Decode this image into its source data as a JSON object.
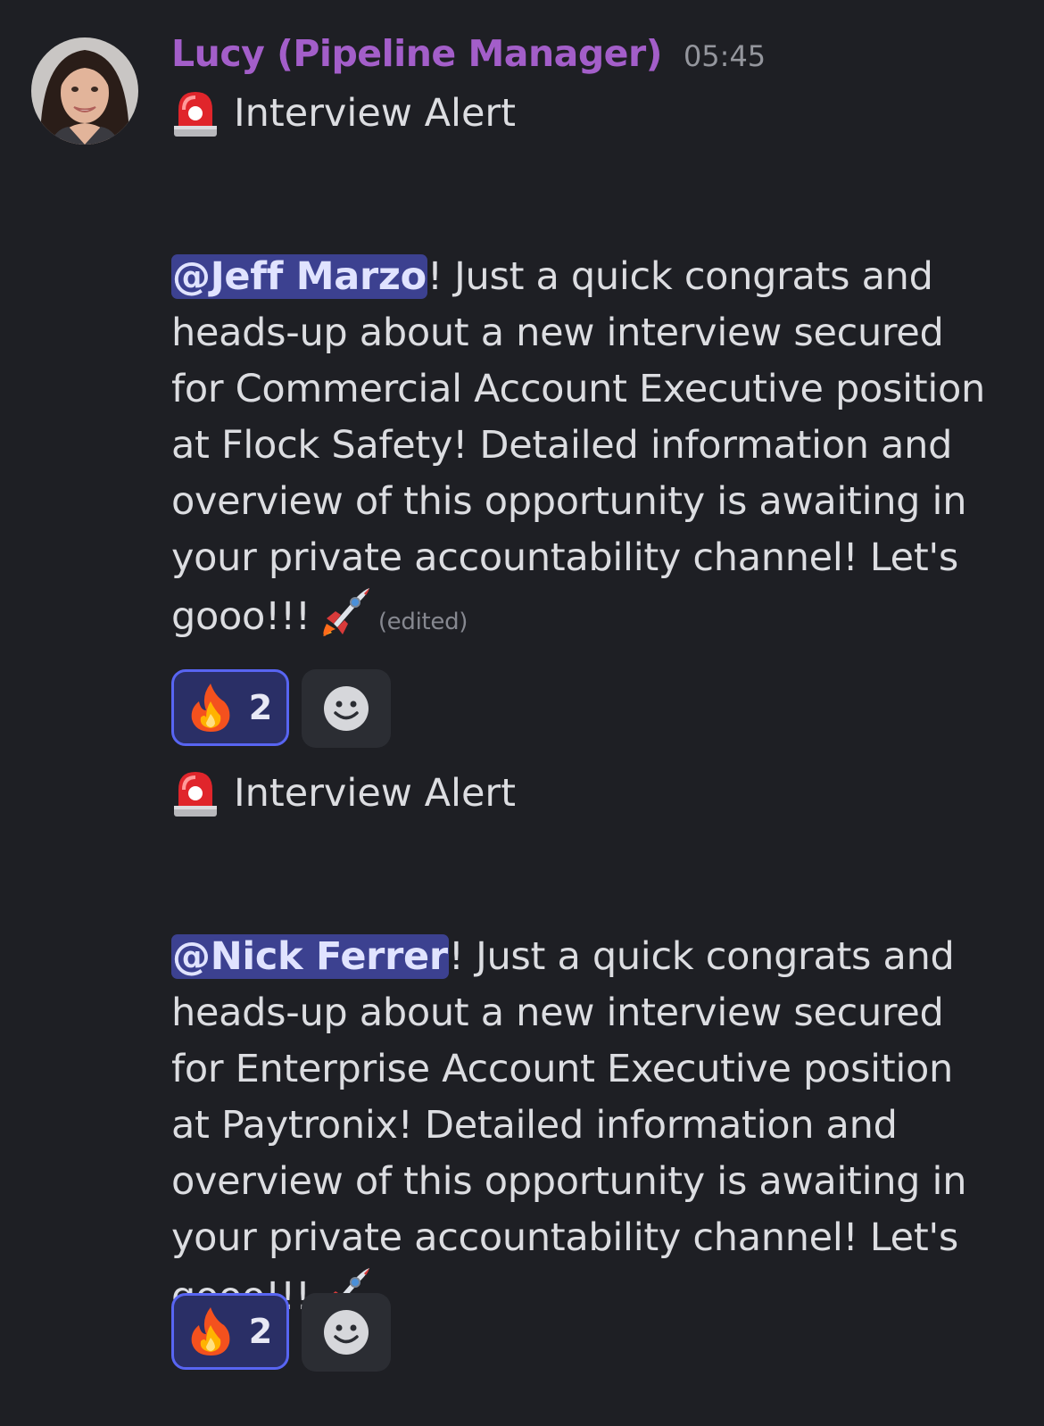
{
  "author": {
    "name": "Lucy (Pipeline Manager)",
    "timestamp": "05:45",
    "avatar_icon": "avatar-woman-portrait",
    "name_color": "#a35ec9"
  },
  "messages": [
    {
      "alert_title": "Interview Alert",
      "alert_icon": "siren-icon",
      "mention": "@Jeff Marzo",
      "body": "! Just a quick congrats and heads-up about a new interview secured for Commercial Account Executive position at Flock Safety! Detailed information and overview of this opportunity is awaiting in your private accountability channel! Let's gooo!!!",
      "trailing_icon": "rocket-icon",
      "edited": "(edited)",
      "reaction": {
        "emoji_icon": "fire-icon",
        "count": "2"
      }
    },
    {
      "alert_title": "Interview Alert",
      "alert_icon": "siren-icon",
      "mention": "@Nick Ferrer",
      "body": "! Just a quick congrats and heads-up about a new interview secured for Enterprise Account Executive position at Paytronix! Detailed information and overview of this opportunity is awaiting in your private accountability channel! Let's gooo!!!",
      "trailing_icon": "rocket-icon",
      "reaction": {
        "emoji_icon": "fire-icon",
        "count": "2"
      }
    }
  ],
  "colors": {
    "background": "#1e1f24",
    "mention_bg": "#3c4190",
    "reaction_border": "#5865f2"
  }
}
